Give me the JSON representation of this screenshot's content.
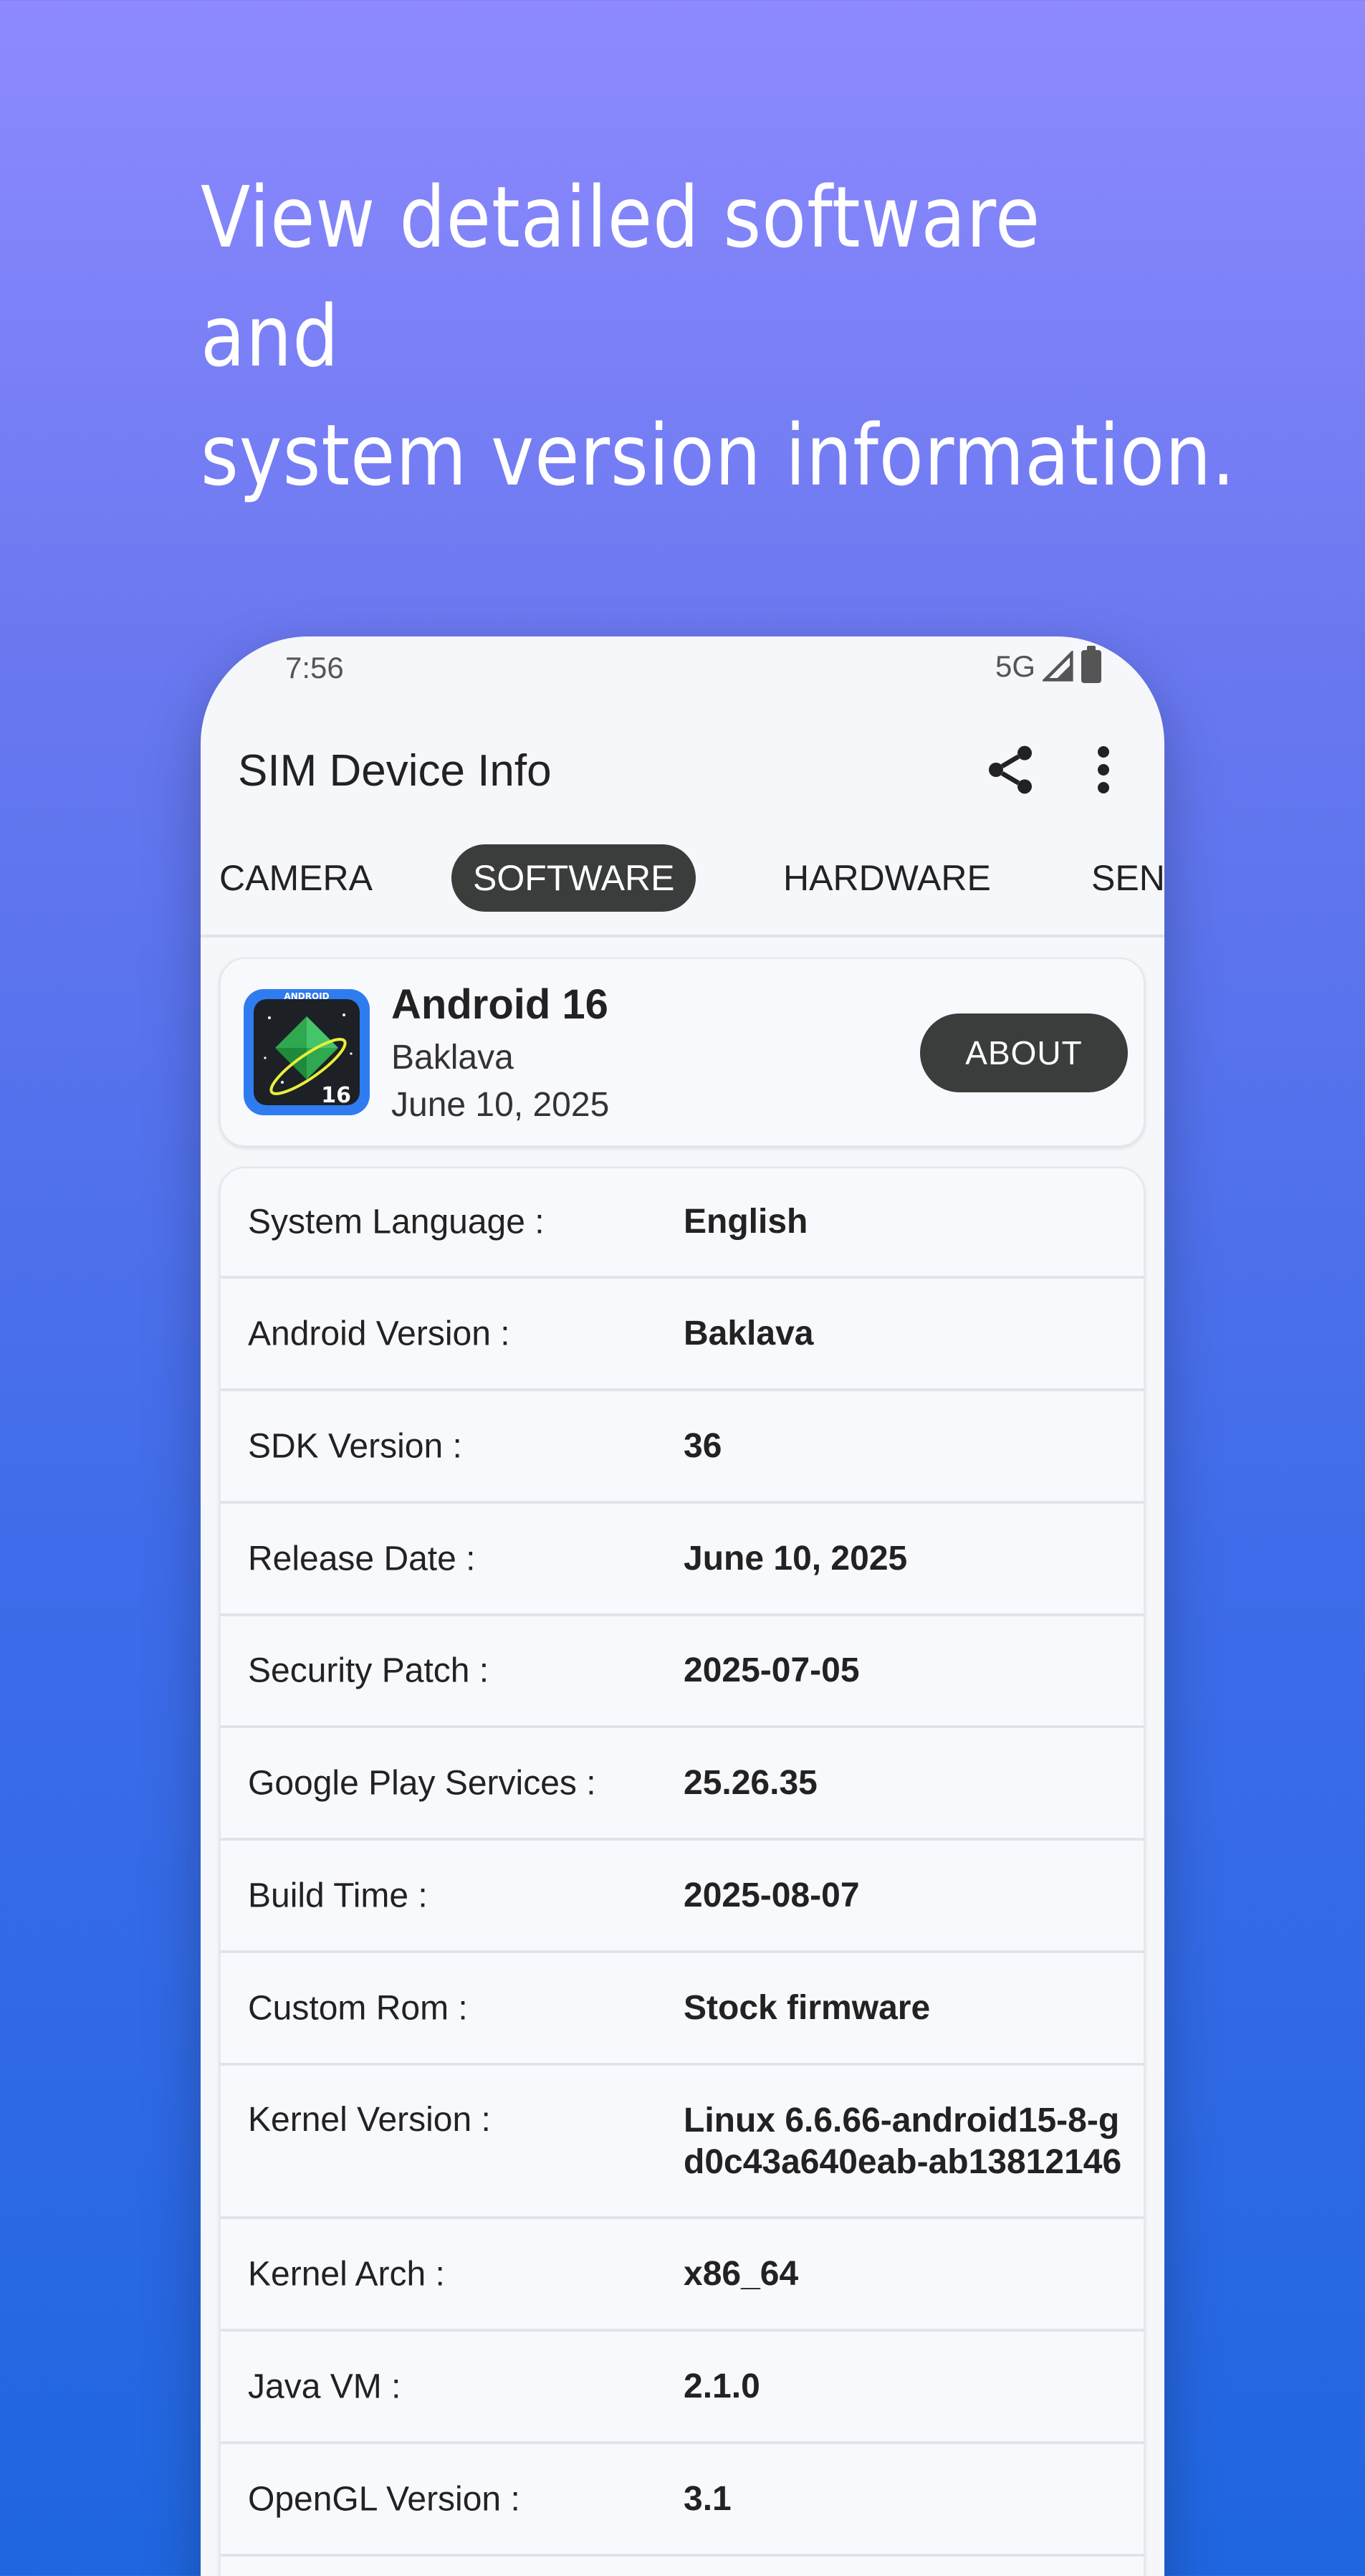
{
  "headline": {
    "line1": "View detailed software",
    "line2": "and",
    "line3": "system version information."
  },
  "status_bar": {
    "time": "7:56",
    "network": "5G"
  },
  "app_bar": {
    "title": "SIM Device Info",
    "share_icon": "share-icon",
    "more_icon": "more-vert-icon"
  },
  "tabs": [
    {
      "label": "CAMERA",
      "active": false
    },
    {
      "label": "SOFTWARE",
      "active": true
    },
    {
      "label": "HARDWARE",
      "active": false
    },
    {
      "label": "SENS",
      "active": false
    }
  ],
  "os_card": {
    "name": "Android 16",
    "codename": "Baklava",
    "release_date": "June 10, 2025",
    "icon_text": "ANDROID",
    "icon_number": "16",
    "about_label": "ABOUT"
  },
  "info_rows": [
    {
      "label": "System Language :",
      "value": "English"
    },
    {
      "label": "Android Version :",
      "value": "Baklava"
    },
    {
      "label": "SDK Version :",
      "value": "36"
    },
    {
      "label": "Release Date :",
      "value": "June 10, 2025"
    },
    {
      "label": "Security Patch :",
      "value": "2025-07-05"
    },
    {
      "label": "Google Play Services :",
      "value": "25.26.35"
    },
    {
      "label": "Build Time :",
      "value": "2025-08-07"
    },
    {
      "label": "Custom Rom :",
      "value": "Stock firmware"
    },
    {
      "label": "Kernel Version :",
      "value": "Linux 6.6.66-android15-8-gd0c43a640eab-ab13812146"
    },
    {
      "label": "Kernel Arch :",
      "value": "x86_64"
    },
    {
      "label": "Java VM :",
      "value": "2.1.0"
    },
    {
      "label": "OpenGL Version :",
      "value": "3.1"
    }
  ],
  "colors": {
    "accent_dark": "#3b3c3c",
    "background_top": "#8e8afe",
    "background_bottom": "#1f66e0"
  }
}
